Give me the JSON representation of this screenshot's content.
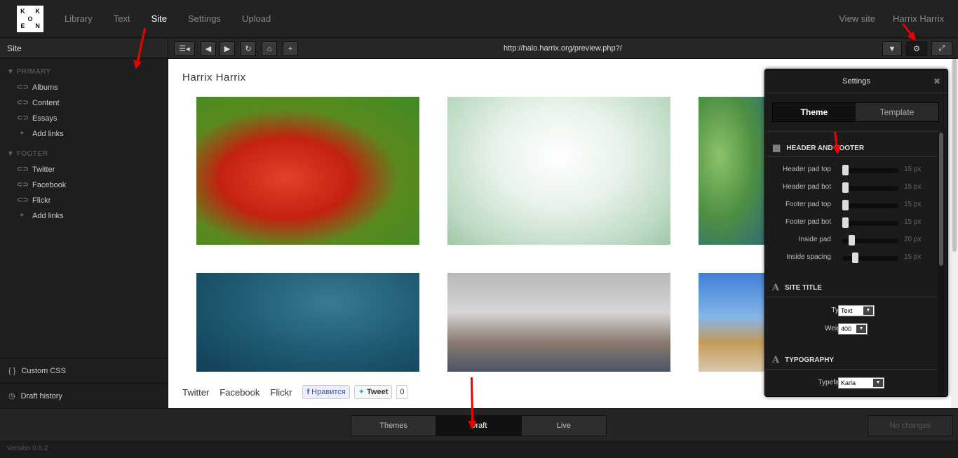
{
  "topbar": {
    "logo_letters": [
      "K",
      "",
      "K",
      "",
      "O",
      "",
      "E",
      "",
      "N"
    ],
    "nav": [
      {
        "label": "Library",
        "active": false
      },
      {
        "label": "Text",
        "active": false
      },
      {
        "label": "Site",
        "active": true
      },
      {
        "label": "Settings",
        "active": false
      },
      {
        "label": "Upload",
        "active": false
      }
    ],
    "view_site": "View site",
    "user": "Harrix Harrix"
  },
  "sidebar": {
    "header": "Site",
    "primary": {
      "title": "PRIMARY",
      "items": [
        {
          "label": "Albums",
          "icon": "link-icon"
        },
        {
          "label": "Content",
          "icon": "link-icon"
        },
        {
          "label": "Essays",
          "icon": "link-icon"
        },
        {
          "label": "Add links",
          "icon": "plus-icon"
        }
      ]
    },
    "footer": {
      "title": "FOOTER",
      "items": [
        {
          "label": "Twitter",
          "icon": "link-icon"
        },
        {
          "label": "Facebook",
          "icon": "link-icon"
        },
        {
          "label": "Flickr",
          "icon": "link-icon"
        },
        {
          "label": "Add links",
          "icon": "plus-icon"
        }
      ]
    },
    "custom_css": "Custom CSS",
    "draft_history": "Draft history"
  },
  "toolbar": {
    "url": "http://halo.harrix.org/preview.php?/"
  },
  "preview": {
    "site_title": "Harrix Harrix",
    "links": [
      "Twitter",
      "Facebook",
      "Flickr"
    ],
    "fb_label": "Нравится",
    "tweet_label": "Tweet",
    "tweet_count": "0"
  },
  "settings": {
    "title": "Settings",
    "tabs": [
      "Theme",
      "Template"
    ],
    "sections": {
      "header_footer": "HEADER AND FOOTER",
      "site_title": "SITE TITLE",
      "typography": "TYPOGRAPHY"
    },
    "sliders": [
      {
        "label": "Header pad top",
        "value": "15 px",
        "level": 0
      },
      {
        "label": "Header pad bot",
        "value": "15 px",
        "level": 0
      },
      {
        "label": "Footer pad top",
        "value": "15 px",
        "level": 0
      },
      {
        "label": "Footer pad bot",
        "value": "15 px",
        "level": 0
      },
      {
        "label": "Inside pad",
        "value": "20 px",
        "level": 0.12
      },
      {
        "label": "Inside spacing",
        "value": "15 px",
        "level": 0.2
      }
    ],
    "type_label": "Type",
    "type_value": "Text",
    "weight_label": "Weight",
    "weight_value": "400",
    "typeface_label": "Typeface",
    "typeface_value": "Karla"
  },
  "bottom": {
    "modes": [
      {
        "label": "Themes",
        "active": false
      },
      {
        "label": "Draft",
        "active": true
      },
      {
        "label": "Live",
        "active": false
      }
    ],
    "no_changes": "No changes",
    "version": "Version 0.6.2"
  }
}
